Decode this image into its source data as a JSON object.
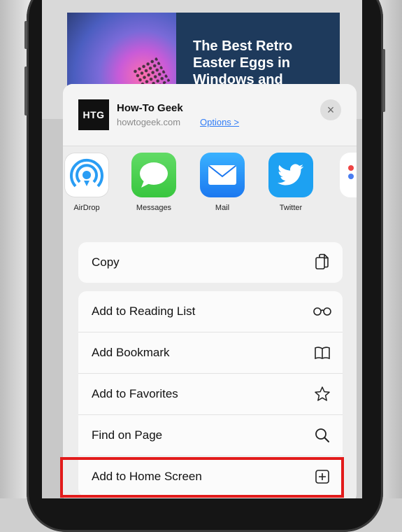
{
  "article": {
    "title": "The Best Retro Easter Eggs in Windows and"
  },
  "share_sheet": {
    "site_logo": "HTG",
    "site_name": "How-To Geek",
    "site_domain": "howtogeek.com",
    "options_label": "Options >",
    "close_label": "×"
  },
  "apps": [
    {
      "label": "AirDrop",
      "icon": "airdrop-icon"
    },
    {
      "label": "Messages",
      "icon": "messages-icon"
    },
    {
      "label": "Mail",
      "icon": "mail-icon"
    },
    {
      "label": "Twitter",
      "icon": "twitter-icon"
    }
  ],
  "actions": {
    "copy": "Copy",
    "reading_list": "Add to Reading List",
    "bookmark": "Add Bookmark",
    "favorites": "Add to Favorites",
    "find": "Find on Page",
    "home_screen": "Add to Home Screen"
  },
  "colors": {
    "highlight": "#e21b1b",
    "link": "#2f7cf6"
  }
}
